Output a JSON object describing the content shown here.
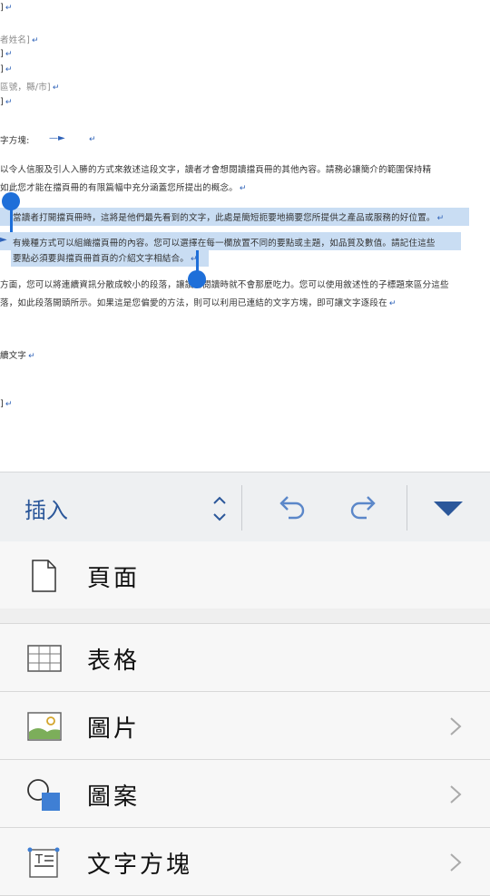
{
  "document": {
    "lines": [
      {
        "text": "]",
        "gray": false
      },
      {
        "text": "者姓名]",
        "gray": true
      },
      {
        "text": "]",
        "gray": false
      },
      {
        "text": "]",
        "gray": false
      },
      {
        "text": "區號，縣/市]",
        "gray": true
      },
      {
        "text": "]",
        "gray": false
      },
      {
        "text": "字方塊:",
        "gray": false
      },
      {
        "text": "以令人信服及引人入勝的方式來敘述這段文字，讀者才會想閱讀擋頁冊的其他內容。請務必讓簡介的範圍保持精",
        "gray": false
      },
      {
        "text": "如此您才能在擋頁冊的有限篇幅中充分涵蓋您所提出的概念。",
        "gray": false
      },
      {
        "text": "當讀者打開擋頁冊時，這將是他們最先看到的文字，此處是簡短扼要地摘要您所提供之產品或服務的好位置。",
        "gray": false
      },
      {
        "text": "有幾種方式可以組織擋頁冊的內容。您可以選擇在每一欄放置不同的要點或主題，如品質及數值。請記住這些",
        "gray": false
      },
      {
        "text": "要點必須要與擋頁冊首頁的介紹文字相結合。",
        "gray": false
      },
      {
        "text": "方面，您可以將連續資訊分散成較小的段落，讓讀者閱讀時就不會那麼吃力。您可以使用敘述性的子標題來區分這些",
        "gray": false
      },
      {
        "text": "落，如此段落開頭所示。如果這是您偏愛的方法，則可以利用已連結的文字方塊，即可讓文字逐段在",
        "gray": false
      },
      {
        "text": "續文字",
        "gray": false
      },
      {
        "text": "]",
        "gray": false
      }
    ],
    "paragraph_mark": "↵"
  },
  "toolbar": {
    "title": "插入",
    "icons": {
      "updown": "chevron-up-down-icon",
      "undo": "undo-icon",
      "redo": "redo-icon",
      "collapse": "triangle-down-icon"
    },
    "accent": "#2b579a"
  },
  "menu": {
    "items": [
      {
        "label": "頁面",
        "icon": "page-icon",
        "chevron": false
      },
      {
        "label": "表格",
        "icon": "table-icon",
        "chevron": false
      },
      {
        "label": "圖片",
        "icon": "picture-icon",
        "chevron": true
      },
      {
        "label": "圖案",
        "icon": "shapes-icon",
        "chevron": true
      },
      {
        "label": "文字方塊",
        "icon": "textbox-icon",
        "chevron": true
      }
    ]
  },
  "colors": {
    "selection": "#c9ddf3",
    "handle": "#1e6fd9",
    "paragraph_mark": "#2e62b8"
  }
}
